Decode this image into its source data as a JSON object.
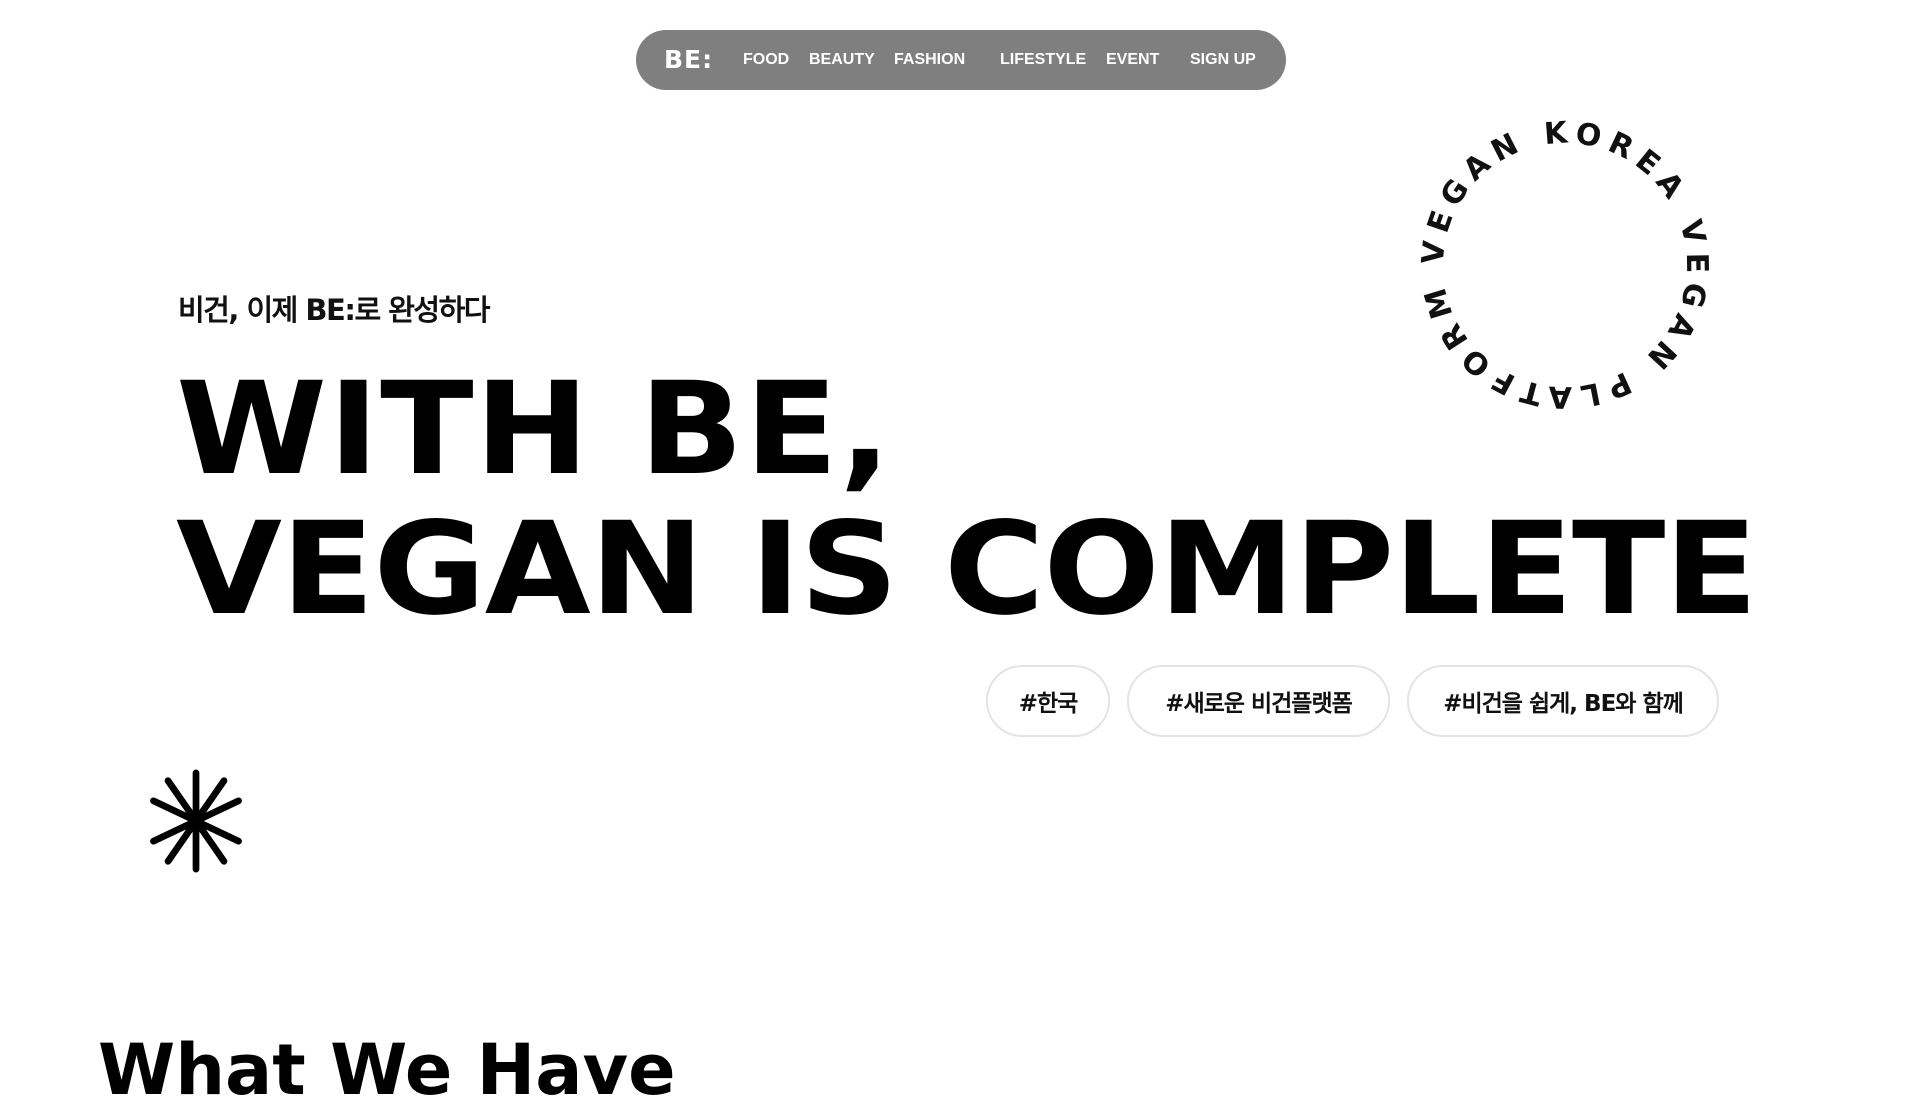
{
  "nav": {
    "logo": "BE:",
    "items": [
      "FOOD",
      "BEAUTY",
      "FASHION",
      "LIFESTYLE",
      "EVENT",
      "SIGN UP"
    ]
  },
  "hero": {
    "subtitle": "비건, 이제 BE:로 완성하다",
    "headline_line1": "WITH BE,",
    "headline_line2": "VEGAN IS COMPLETE",
    "badge_text": "VEGAN KOREA VEGAN PLATFORM"
  },
  "tags": [
    "#한국",
    "#새로운 비건플랫폼",
    "#비건을 쉽게, BE와 함께"
  ],
  "section": {
    "title": "What We Have"
  },
  "icons": {
    "decoration": "asterisk-icon"
  },
  "colors": {
    "nav_background": "#7f7f7f",
    "text": "#000000",
    "tag_border": "#e4e4e4"
  }
}
